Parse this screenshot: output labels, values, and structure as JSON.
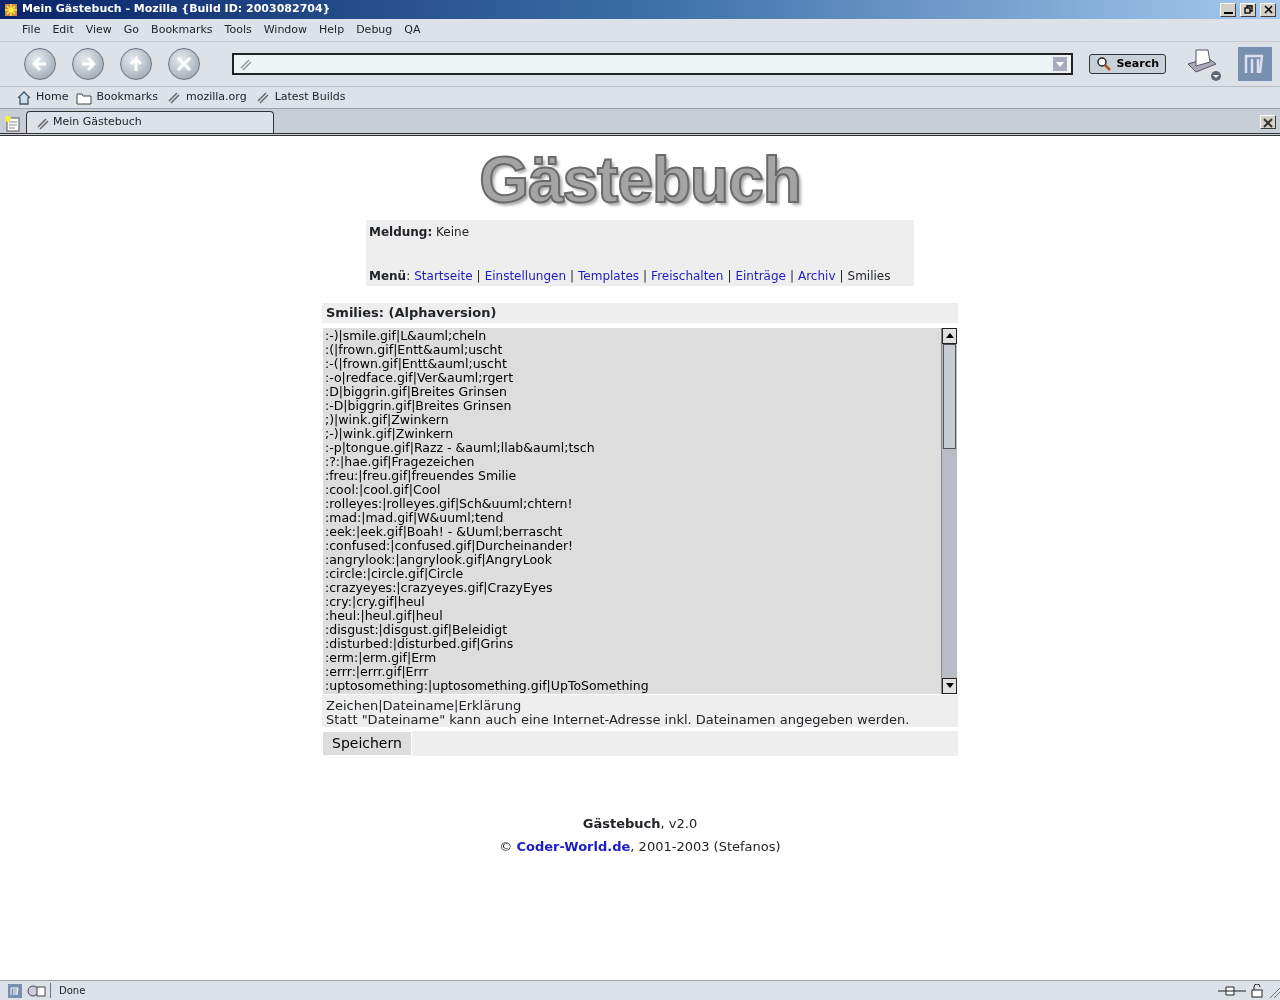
{
  "window": {
    "title": "Mein Gästebuch - Mozilla {Build ID: 2003082704}"
  },
  "menu_bar": [
    "File",
    "Edit",
    "View",
    "Go",
    "Bookmarks",
    "Tools",
    "Window",
    "Help",
    "Debug",
    "QA"
  ],
  "navigation": {
    "search_button": "Search"
  },
  "bookmarks_bar": [
    {
      "kind": "home",
      "label": "Home"
    },
    {
      "kind": "folder",
      "label": "Bookmarks"
    },
    {
      "kind": "link",
      "label": "mozilla.org"
    },
    {
      "kind": "link",
      "label": "Latest Builds"
    }
  ],
  "tabs": [
    {
      "label": "Mein Gästebuch",
      "selected": true
    }
  ],
  "page": {
    "logo": "Gästebuch",
    "message": {
      "label": "Meldung:",
      "value": "Keine"
    },
    "menu": {
      "label": "**Menü**:",
      "items": [
        {
          "label": "Startseite",
          "selected": false
        },
        {
          "separator": "|",
          "label": "Einstellungen",
          "selected": false
        },
        {
          "separator": "|",
          "label": "Templates",
          "selected": false
        },
        {
          "separator": "|",
          "label": "Freischalten",
          "selected": false
        },
        {
          "separator": "|",
          "label": "Einträge",
          "selected": false
        },
        {
          "separator": "|",
          "label": "Archiv",
          "selected": false
        },
        {
          "separator": "|",
          "label": "Smilies",
          "selected": true
        }
      ]
    },
    "section_title": "Smilies: (Alphaversion)",
    "smilies_lines": [
      ":-)|smile.gif|L&auml;cheln",
      ":(|frown.gif|Entt&auml;uscht",
      ":-(|frown.gif|Entt&auml;uscht",
      ":-o|redface.gif|Ver&auml;rgert",
      ":D|biggrin.gif|Breites Grinsen",
      ":-D|biggrin.gif|Breites Grinsen",
      ";)|wink.gif|Zwinkern",
      ";-)|wink.gif|Zwinkern",
      ":-p|tongue.gif|Razz - &auml;llab&auml;tsch",
      ":?:|hae.gif|Fragezeichen",
      ":freu:|freu.gif|freuendes Smilie",
      ":cool:|cool.gif|Cool",
      ":rolleyes:|rolleyes.gif|Sch&uuml;chtern!",
      ":mad:|mad.gif|W&uuml;tend",
      ":eek:|eek.gif|Boah! - &Uuml;berrascht",
      ":confused:|confused.gif|Durcheinander!",
      ":angrylook:|angrylook.gif|AngryLook",
      ":circle:|circle.gif|Circle",
      ":crazyeyes:|crazyeyes.gif|CrazyEyes",
      ":cry:|cry.gif|heul",
      ":heul:|heul.gif|heul",
      ":disgust:|disgust.gif|Beleidigt",
      ":disturbed:|disturbed.gif|Grins",
      ":erm:|erm.gif|Erm",
      ":errr:|errr.gif|Errr",
      ":uptosomething:|uptosomething.gif|UpToSomething"
    ],
    "format_hint": "Zeichen|Dateiname|Erklärung",
    "note": "Statt \"Dateiname\" kann auch eine Internet-Adresse inkl. Dateinamen angegeben werden.",
    "save_button": "Speichern",
    "footer": {
      "line1": "**Gästebuch**, v2.0",
      "copyright": "©",
      "link": "Coder-World.de",
      "rest": ", 2001-2003 (Stefanos)"
    }
  },
  "status_bar": {
    "text": "Done"
  }
}
